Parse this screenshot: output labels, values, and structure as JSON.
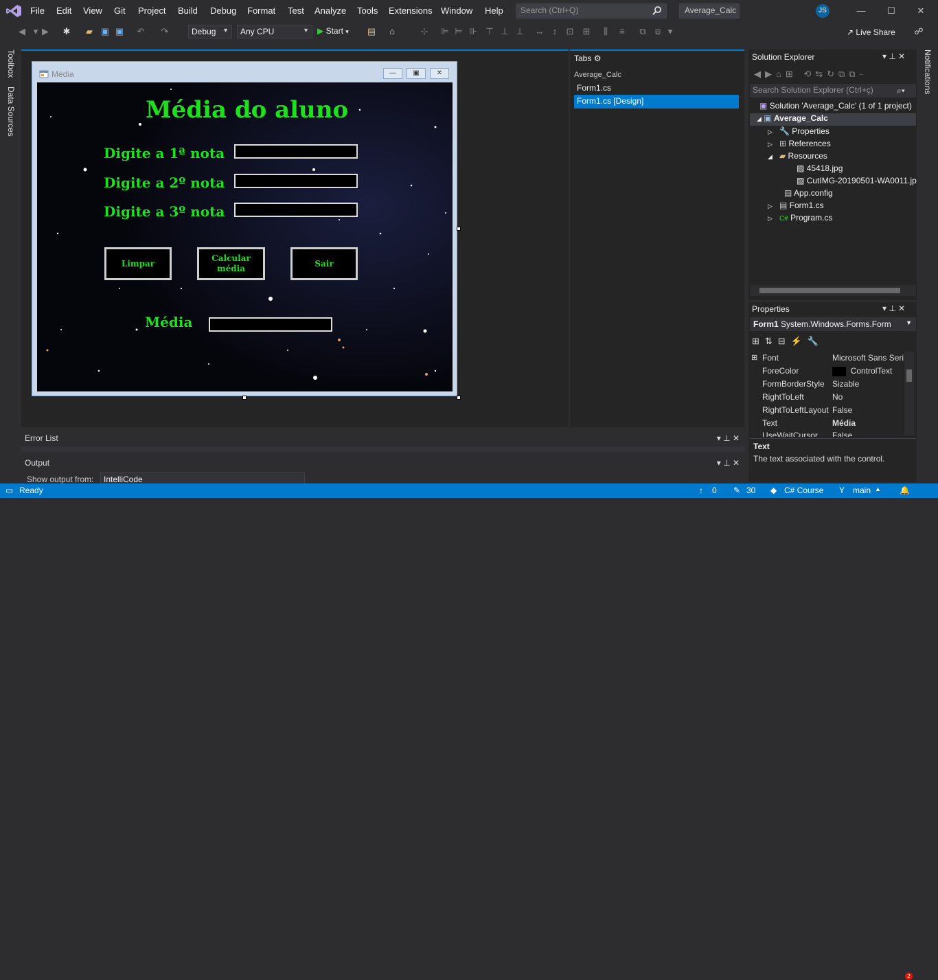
{
  "menu": [
    "File",
    "Edit",
    "View",
    "Git",
    "Project",
    "Build",
    "Debug",
    "Format",
    "Test",
    "Analyze",
    "Tools",
    "Extensions",
    "Window",
    "Help"
  ],
  "search": {
    "placeholder": "Search (Ctrl+Q)"
  },
  "project_title": "Average_Calc",
  "user_initials": "JS",
  "toolbar": {
    "config": "Debug",
    "platform": "Any CPU",
    "start": "Start",
    "live_share": "Live Share"
  },
  "left_tabs": [
    "Toolbox",
    "Data Sources"
  ],
  "right_tabs": [
    "Notifications"
  ],
  "form": {
    "window_title": "Média",
    "heading": "Média do aluno",
    "label1": "Digite a 1ª nota",
    "label2": "Digite a 2º nota",
    "label3": "Digite a 3º nota",
    "btn_clear": "Limpar",
    "btn_calc_line1": "Calcular",
    "btn_calc_line2": "média",
    "btn_exit": "Sair",
    "result_label": "Média"
  },
  "tabs_panel": {
    "title": "Tabs",
    "group": "Average_Calc",
    "items": [
      "Form1.cs",
      "Form1.cs [Design]"
    ]
  },
  "error_list": {
    "title": "Error List"
  },
  "output": {
    "title": "Output",
    "show_from": "Show output from:",
    "source": "IntelliCode"
  },
  "solution_explorer": {
    "title": "Solution Explorer",
    "search_placeholder": "Search Solution Explorer (Ctrl+ç)",
    "solution": "Solution 'Average_Calc' (1 of 1 project)",
    "project": "Average_Calc",
    "items": [
      "Properties",
      "References",
      "Resources",
      "45418.jpg",
      "CutIMG-20190501-WA0011.jpg",
      "App.config",
      "Form1.cs",
      "Program.cs"
    ]
  },
  "properties": {
    "title": "Properties",
    "object": "Form1",
    "type": "System.Windows.Forms.Form",
    "rows": [
      {
        "name": "Font",
        "value": "Microsoft Sans Serif"
      },
      {
        "name": "ForeColor",
        "value": "ControlText"
      },
      {
        "name": "FormBorderStyle",
        "value": "Sizable"
      },
      {
        "name": "RightToLeft",
        "value": "No"
      },
      {
        "name": "RightToLeftLayout",
        "value": "False"
      },
      {
        "name": "Text",
        "value": "Média"
      },
      {
        "name": "UseWaitCursor",
        "value": "False"
      }
    ],
    "desc_title": "Text",
    "desc": "The text associated with the control."
  },
  "status": {
    "ready": "Ready",
    "up_count": "0",
    "edits": "30",
    "lang": "C# Course",
    "branch": "main",
    "notif_count": "2"
  },
  "colors": {
    "accent": "#007acc",
    "form_text": "#1ee01e"
  }
}
